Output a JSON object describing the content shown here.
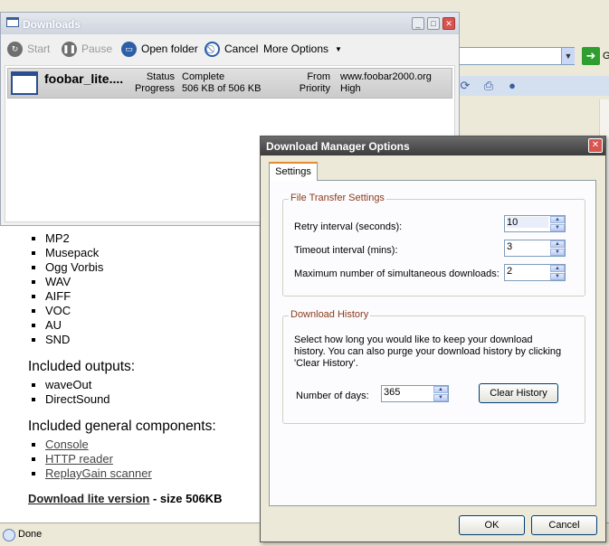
{
  "browser": {
    "go_label": "G",
    "status_text": "Done"
  },
  "page": {
    "formats": [
      "MP2",
      "Musepack",
      "Ogg Vorbis",
      "WAV",
      "AIFF",
      "VOC",
      "AU",
      "SND"
    ],
    "outputs_heading": "Included outputs:",
    "outputs": [
      "waveOut",
      "DirectSound"
    ],
    "components_heading": "Included general components:",
    "components": [
      "Console",
      "HTTP reader",
      "ReplayGain scanner"
    ],
    "download_link": "Download lite version",
    "download_size": " - size 506KB"
  },
  "downloads_window": {
    "title": "Downloads",
    "toolbar": {
      "start": "Start",
      "pause": "Pause",
      "open_folder": "Open folder",
      "cancel": "Cancel",
      "more_options": "More Options"
    },
    "item": {
      "name": "foobar_lite....",
      "status_label": "Status",
      "status_value": "Complete",
      "progress_label": "Progress",
      "progress_value": "506 KB of 506 KB",
      "from_label": "From",
      "from_value": "www.foobar2000.org",
      "priority_label": "Priority",
      "priority_value": "High"
    }
  },
  "options_dialog": {
    "title": "Download Manager Options",
    "tab": "Settings",
    "file_transfer": {
      "title": "File Transfer Settings",
      "retry_label": "Retry interval (seconds):",
      "retry_value": "10",
      "timeout_label": "Timeout interval (mins):",
      "timeout_value": "3",
      "max_label": "Maximum number of simultaneous downloads:",
      "max_value": "2"
    },
    "history": {
      "title": "Download History",
      "description": "Select how long you would like to keep your download history. You can also purge your download history by clicking 'Clear History'.",
      "days_label": "Number of days:",
      "days_value": "365",
      "clear_button": "Clear History"
    },
    "ok_button": "OK",
    "cancel_button": "Cancel"
  }
}
